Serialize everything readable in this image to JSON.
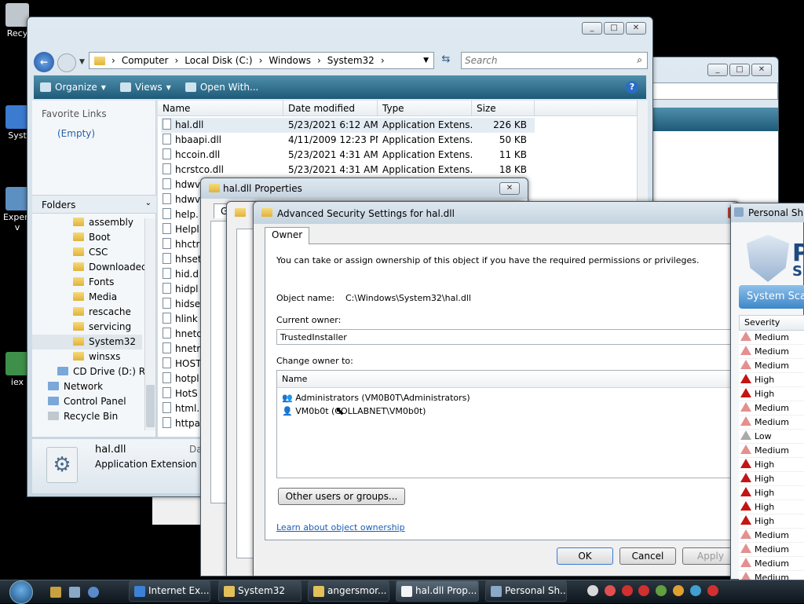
{
  "desktop": {
    "icons": [
      {
        "label": "Recy"
      },
      {
        "label": "Syst"
      },
      {
        "label": "Expert\nv"
      },
      {
        "label": "iex"
      }
    ]
  },
  "explorer": {
    "address": [
      "Computer",
      "Local Disk (C:)",
      "Windows",
      "System32"
    ],
    "search_placeholder": "Search",
    "toolbar": {
      "organize": "Organize",
      "views": "Views",
      "open_with": "Open With..."
    },
    "favorite_links_title": "Favorite Links",
    "favorite_links_empty": "(Empty)",
    "folders_title": "Folders",
    "tree": [
      "assembly",
      "Boot",
      "CSC",
      "Downloaded",
      "Fonts",
      "Media",
      "rescache",
      "servicing",
      "System32",
      "winsxs",
      "CD Drive (D:) Ro",
      "Network",
      "Control Panel",
      "Recycle Bin"
    ],
    "columns": {
      "name": "Name",
      "date": "Date modified",
      "type": "Type",
      "size": "Size"
    },
    "files": [
      {
        "name": "hal.dll",
        "date": "5/23/2021 6:12 AM",
        "type": "Application Extens...",
        "size": "226 KB"
      },
      {
        "name": "hbaapi.dll",
        "date": "4/11/2009 12:23 PM",
        "type": "Application Extens...",
        "size": "50 KB"
      },
      {
        "name": "hccoin.dll",
        "date": "5/23/2021 4:31 AM",
        "type": "Application Extens...",
        "size": "11 KB"
      },
      {
        "name": "hcrstco.dll",
        "date": "5/23/2021 4:31 AM",
        "type": "Application Extens...",
        "size": "18 KB"
      },
      {
        "name": "hdwv",
        "date": "",
        "type": "",
        "size": ""
      },
      {
        "name": "hdwv",
        "date": "",
        "type": "",
        "size": ""
      },
      {
        "name": "help.",
        "date": "",
        "type": "",
        "size": ""
      },
      {
        "name": "Helpl",
        "date": "",
        "type": "",
        "size": ""
      },
      {
        "name": "hhctr",
        "date": "",
        "type": "",
        "size": ""
      },
      {
        "name": "hhset",
        "date": "",
        "type": "",
        "size": ""
      },
      {
        "name": "hid.d",
        "date": "",
        "type": "",
        "size": ""
      },
      {
        "name": "hidpl",
        "date": "",
        "type": "",
        "size": ""
      },
      {
        "name": "hidse",
        "date": "",
        "type": "",
        "size": ""
      },
      {
        "name": "hlink",
        "date": "",
        "type": "",
        "size": ""
      },
      {
        "name": "hnetc",
        "date": "",
        "type": "",
        "size": ""
      },
      {
        "name": "hnetr",
        "date": "",
        "type": "",
        "size": ""
      },
      {
        "name": "HOST",
        "date": "",
        "type": "",
        "size": ""
      },
      {
        "name": "hotpl",
        "date": "",
        "type": "",
        "size": ""
      },
      {
        "name": "HotS",
        "date": "",
        "type": "",
        "size": ""
      },
      {
        "name": "html.",
        "date": "",
        "type": "",
        "size": ""
      },
      {
        "name": "httpa",
        "date": "",
        "type": "",
        "size": ""
      }
    ],
    "details": {
      "name": "hal.dll",
      "type": "Application Extension",
      "date_label": "Da"
    }
  },
  "properties": {
    "title": "hal.dll Properties",
    "tab_partial": "Ge"
  },
  "advanced": {
    "title": "Advanced Security Settings for hal.dll",
    "tab": "Owner",
    "intro": "You can take or assign ownership of this object if you have the required permissions or privileges.",
    "object_name_label": "Object name:",
    "object_name_value": "C:\\Windows\\System32\\hal.dll",
    "current_owner_label": "Current owner:",
    "current_owner_value": "TrustedInstaller",
    "change_owner_label": "Change owner to:",
    "name_col": "Name",
    "owners": [
      "Administrators (VM0B0T\\Administrators)",
      "VM0b0t (COLLABNET\\VM0b0t)"
    ],
    "other_users_button": "Other users or groups...",
    "learn_link": "Learn about object ownership",
    "ok": "OK",
    "cancel": "Cancel",
    "apply": "Apply"
  },
  "shield": {
    "title": "Personal Shie",
    "logo_text_1": "P",
    "logo_text_2": "SI",
    "scan_button": "System Scan",
    "severity_header": "Severity",
    "rows": [
      {
        "level": "Medium",
        "kind": "medium"
      },
      {
        "level": "Medium",
        "kind": "medium"
      },
      {
        "level": "Medium",
        "kind": "medium"
      },
      {
        "level": "High",
        "kind": "high"
      },
      {
        "level": "High",
        "kind": "high"
      },
      {
        "level": "Medium",
        "kind": "medium"
      },
      {
        "level": "Medium",
        "kind": "medium"
      },
      {
        "level": "Low",
        "kind": "low"
      },
      {
        "level": "Medium",
        "kind": "medium"
      },
      {
        "level": "High",
        "kind": "high"
      },
      {
        "level": "High",
        "kind": "high"
      },
      {
        "level": "High",
        "kind": "high"
      },
      {
        "level": "High",
        "kind": "high"
      },
      {
        "level": "High",
        "kind": "high"
      },
      {
        "level": "Medium",
        "kind": "medium"
      },
      {
        "level": "Medium",
        "kind": "medium"
      },
      {
        "level": "Medium",
        "kind": "medium"
      },
      {
        "level": "Medium",
        "kind": "medium"
      }
    ]
  },
  "taskbar": {
    "buttons": [
      "Internet Ex...",
      "System32",
      "angersmor...",
      "hal.dll Prop...",
      "Personal Sh..."
    ]
  }
}
